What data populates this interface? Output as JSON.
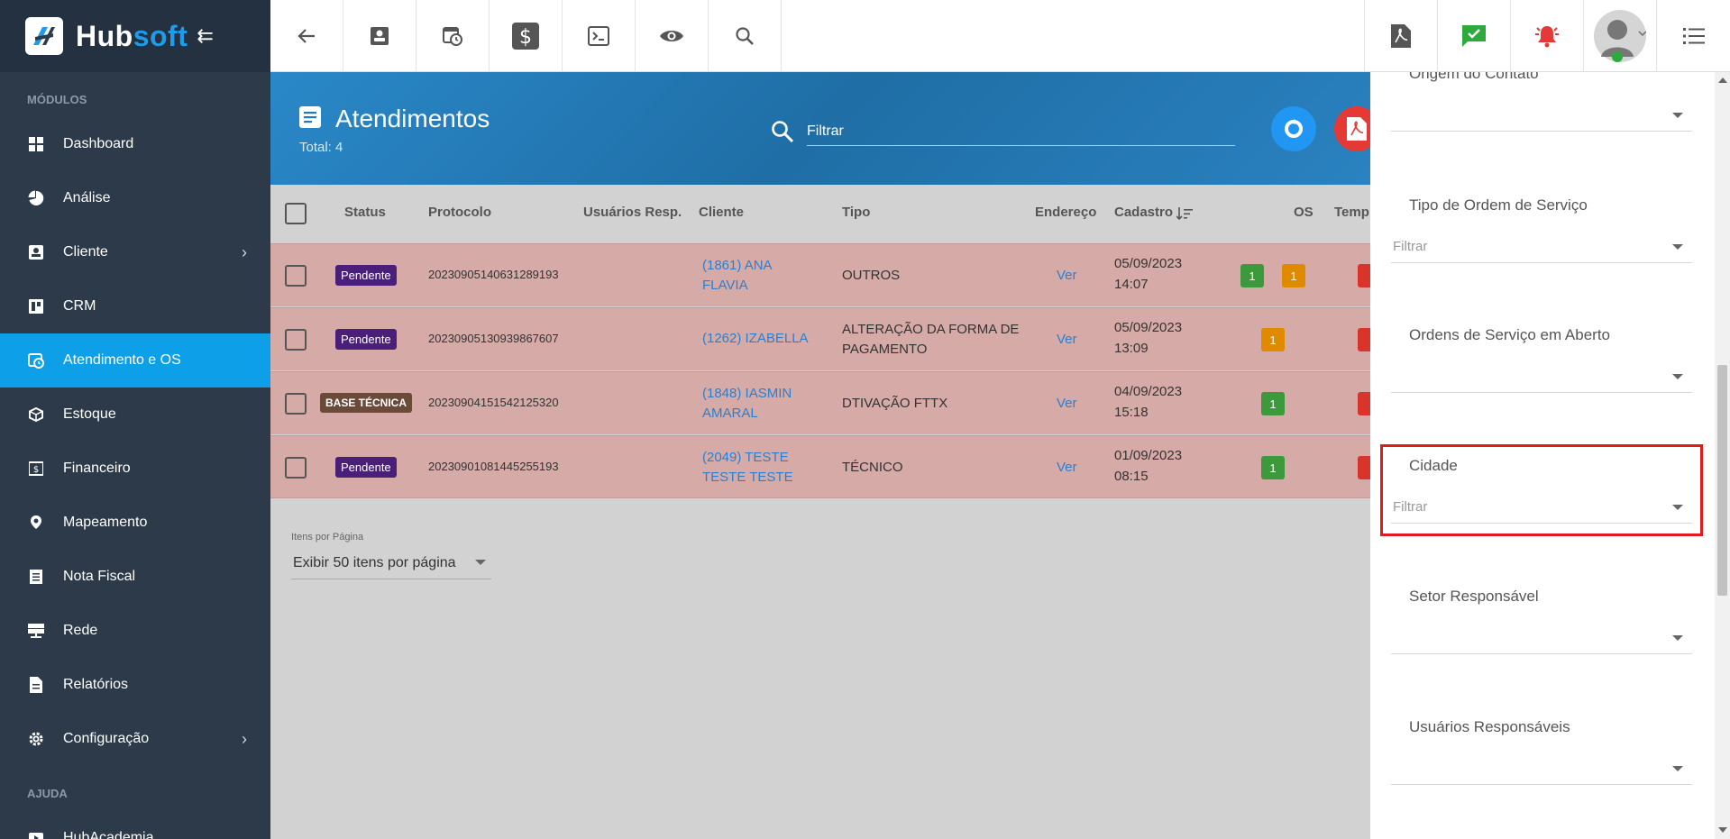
{
  "brand": {
    "name_part1": "Hub",
    "name_part2": "soft"
  },
  "sidebar": {
    "section_modules": "MÓDULOS",
    "section_help": "AJUDA",
    "items": [
      {
        "label": "Dashboard",
        "icon": "dashboard-icon"
      },
      {
        "label": "Análise",
        "icon": "pie-chart-icon"
      },
      {
        "label": "Cliente",
        "icon": "contact-card-icon",
        "has_submenu": true
      },
      {
        "label": "CRM",
        "icon": "crm-board-icon"
      },
      {
        "label": "Atendimento e OS",
        "icon": "calendar-clock-icon",
        "active": true
      },
      {
        "label": "Estoque",
        "icon": "box-icon"
      },
      {
        "label": "Financeiro",
        "icon": "money-icon"
      },
      {
        "label": "Mapeamento",
        "icon": "map-pin-icon"
      },
      {
        "label": "Nota Fiscal",
        "icon": "invoice-icon"
      },
      {
        "label": "Rede",
        "icon": "network-icon"
      },
      {
        "label": "Relatórios",
        "icon": "report-icon"
      },
      {
        "label": "Configuração",
        "icon": "gear-icon",
        "has_submenu": true
      }
    ],
    "help_items": [
      {
        "label": "HubAcademia",
        "icon": "play-icon"
      }
    ]
  },
  "header": {
    "title": "Atendimentos",
    "total": "Total: 4",
    "filter_placeholder": "Filtrar"
  },
  "table": {
    "columns": [
      "Status",
      "Protocolo",
      "Usuários Resp.",
      "Cliente",
      "Tipo",
      "Endereço",
      "Cadastro",
      "OS",
      "Temp"
    ],
    "rows": [
      {
        "status": "Pendente",
        "status_color": "#4a1f7a",
        "protocolo": "20230905140631289193",
        "cliente": "(1861) ANA FLAVIA",
        "tipo": "OUTROS",
        "endereco": "Ver",
        "cadastro_date": "05/09/2023",
        "cadastro_time": "14:07",
        "os": [
          "1",
          "1"
        ],
        "os_colors": [
          "#3c9a3c",
          "#e08a00"
        ]
      },
      {
        "status": "Pendente",
        "status_color": "#4a1f7a",
        "protocolo": "20230905130939867607",
        "cliente": "(1262) IZABELLA",
        "tipo": "ALTERAÇÃO DA FORMA DE PAGAMENTO",
        "endereco": "Ver",
        "cadastro_date": "05/09/2023",
        "cadastro_time": "13:09",
        "os": [
          "1"
        ],
        "os_colors": [
          "#e08a00"
        ]
      },
      {
        "status": "BASE TÉCNICA",
        "status_color": "#6b4a3a",
        "protocolo": "20230904151542125320",
        "cliente": "(1848) IASMIN AMARAL",
        "tipo": "DTIVAÇÃO FTTX",
        "endereco": "Ver",
        "cadastro_date": "04/09/2023",
        "cadastro_time": "15:18",
        "os": [
          "1"
        ],
        "os_colors": [
          "#3c9a3c"
        ]
      },
      {
        "status": "Pendente",
        "status_color": "#4a1f7a",
        "protocolo": "20230901081445255193",
        "cliente": "(2049) TESTE TESTE TESTE",
        "tipo": "TÉCNICO",
        "endereco": "Ver",
        "cadastro_date": "01/09/2023",
        "cadastro_time": "08:15",
        "os": [
          "1"
        ],
        "os_colors": [
          "#3c9a3c"
        ]
      }
    ]
  },
  "pagination": {
    "label": "Itens por Página",
    "value": "Exibir 50 itens por página"
  },
  "filter_panel": {
    "fields": [
      {
        "label": "Origem do Contato",
        "value": ""
      },
      {
        "label": "Tipo de Ordem de Serviço",
        "value": "Filtrar"
      },
      {
        "label": "Ordens de Serviço em Aberto",
        "value": ""
      },
      {
        "label": "Cidade",
        "value": "Filtrar"
      },
      {
        "label": "Setor Responsável",
        "value": ""
      },
      {
        "label": "Usuários Responsáveis",
        "value": ""
      }
    ]
  },
  "colors": {
    "sidebar_bg": "#2c3a4a",
    "active_item": "#0d9fe8",
    "header_band": "#247ab8",
    "row_bg": "#d6aaa6",
    "highlight": "#e01b1b"
  }
}
